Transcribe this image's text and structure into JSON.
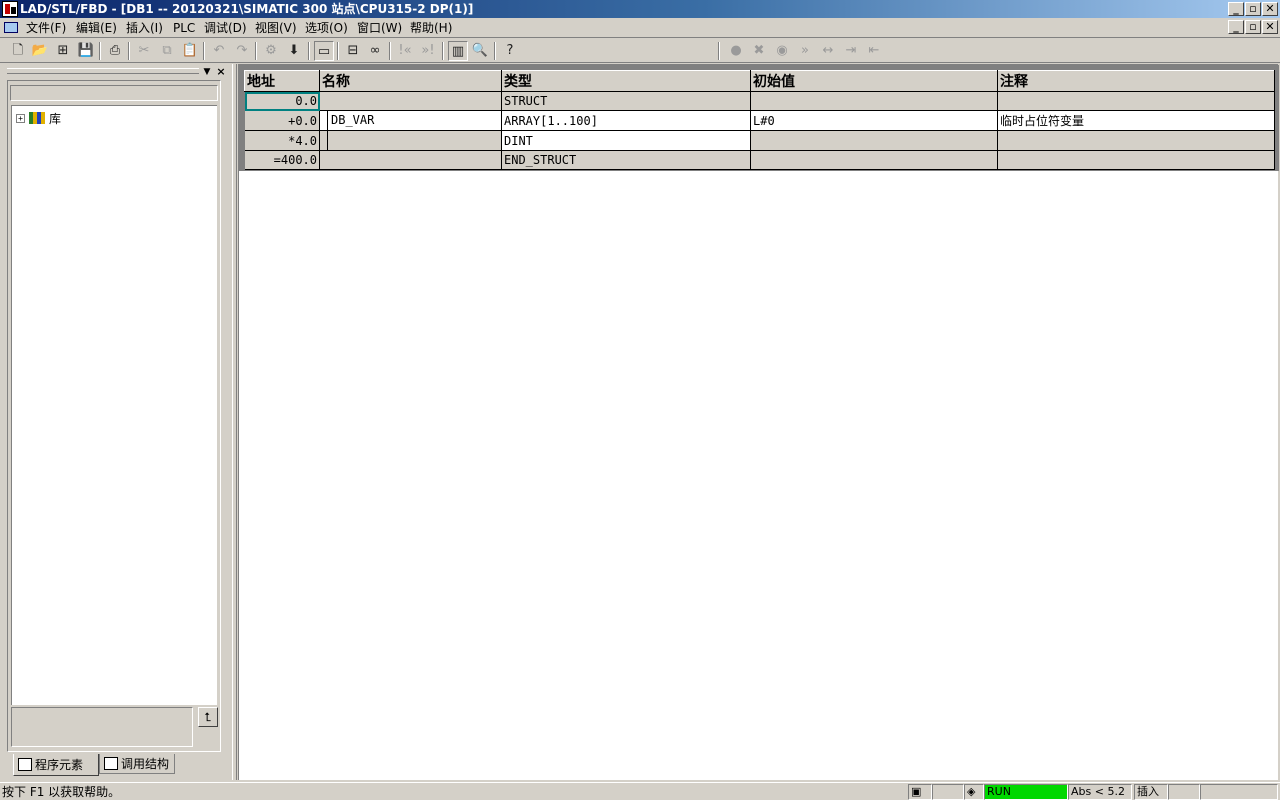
{
  "window": {
    "title": "LAD/STL/FBD  - [DB1 -- 20120321\\SIMATIC 300 站点\\CPU315-2 DP(1)]"
  },
  "caption_buttons": {
    "minimize": "_",
    "restore": "▫",
    "close": "✕"
  },
  "menu": {
    "items": [
      "文件(F)",
      "编辑(E)",
      "插入(I)",
      "PLC",
      "调试(D)",
      "视图(V)",
      "选项(O)",
      "窗口(W)",
      "帮助(H)"
    ]
  },
  "toolbar": {
    "icons": [
      "new-icon",
      "open-icon",
      "network-icon",
      "save-icon",
      "print-icon",
      "cut-icon",
      "copy-icon",
      "paste-icon",
      "undo-icon",
      "redo-icon",
      "compile-icon",
      "download-icon",
      "monitor-icon",
      "details-icon",
      "glasses-icon",
      "prev-error-icon",
      "next-error-icon",
      "overview-icon",
      "zoom-icon",
      "help-icon"
    ]
  },
  "left_panel": {
    "tree": [
      {
        "label": "库",
        "expander": "+"
      }
    ],
    "collapse_button": "⮤",
    "tabs": [
      {
        "label": "程序元素",
        "active": true
      },
      {
        "label": "调用结构",
        "active": false
      }
    ]
  },
  "table": {
    "headers": [
      "地址",
      "名称",
      "类型",
      "初始值",
      "注释"
    ],
    "rows": [
      {
        "address": "0.0",
        "name": "",
        "type": "STRUCT",
        "initial": "",
        "comment": ""
      },
      {
        "address": "+0.0",
        "name": "DB_VAR",
        "type": "ARRAY[1..100]",
        "initial": "L#0",
        "comment": "临时占位符变量"
      },
      {
        "address": "*4.0",
        "name": "",
        "type": "DINT",
        "initial": "",
        "comment": ""
      },
      {
        "address": "=400.0",
        "name": "",
        "type": "END_STRUCT",
        "initial": "",
        "comment": ""
      }
    ]
  },
  "status": {
    "help_text": "按下 F1 以获取帮助。",
    "run_label": "RUN",
    "abs_label": "Abs < 5.2",
    "mode_label": "插入",
    "run_color": "#00d800"
  }
}
